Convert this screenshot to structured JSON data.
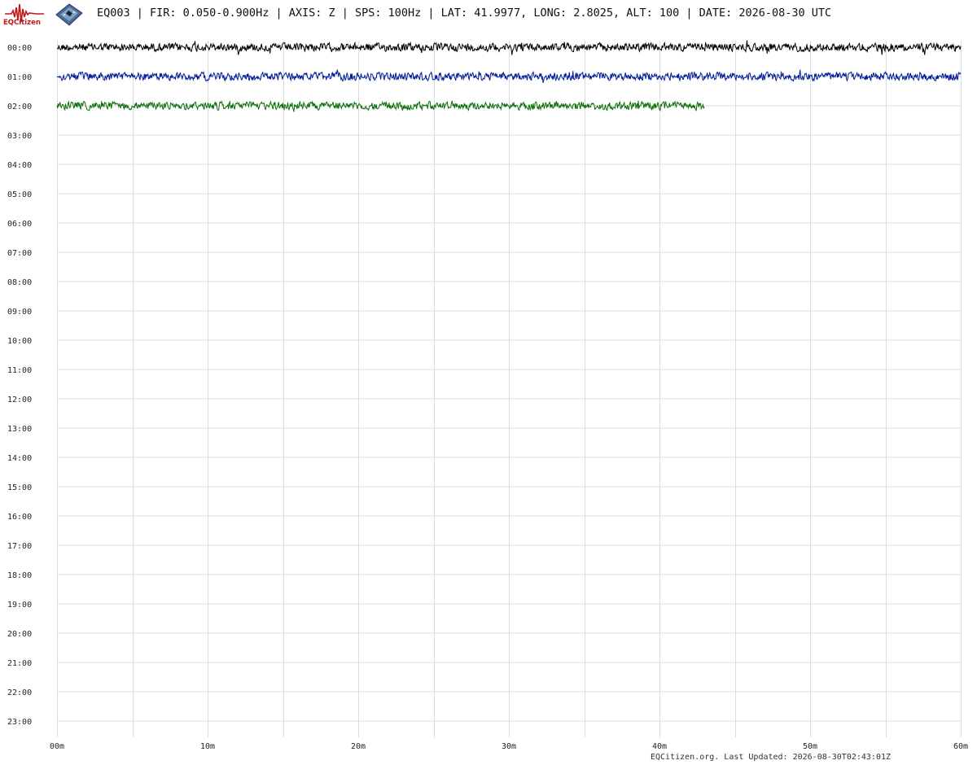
{
  "header": {
    "logo_text": "EQCitizen",
    "title": "EQ003 | FIR: 0.050-0.900Hz | AXIS: Z | SPS: 100Hz | LAT: 41.9977, LONG: 2.8025, ALT: 100 | DATE: 2026-08-30 UTC"
  },
  "footer": {
    "text": "EQCitizen.org. Last Updated: 2026-08-30T02:43:01Z"
  },
  "colors": {
    "grid": "#dcdcdc",
    "trace_colors": [
      "#000000",
      "#001a99",
      "#0a6e0a"
    ],
    "logo": "#c01818"
  },
  "icons": [
    "eqcitizen-logo-icon",
    "sensor-board-icon"
  ],
  "chart_data": {
    "type": "line",
    "title": "EQ003 | FIR: 0.050-0.900Hz | AXIS: Z | SPS: 100Hz | LAT: 41.9977, LONG: 2.8025, ALT: 100 | DATE: 2026-08-30 UTC",
    "xlabel": "",
    "ylabel": "",
    "x_ticks": [
      "00m",
      "10m",
      "20m",
      "30m",
      "40m",
      "50m",
      "60m"
    ],
    "x_range_minutes": [
      0,
      60
    ],
    "x_minor_grid_minutes": 5,
    "y_labels": [
      "00:00",
      "01:00",
      "02:00",
      "03:00",
      "04:00",
      "05:00",
      "06:00",
      "07:00",
      "08:00",
      "09:00",
      "10:00",
      "11:00",
      "12:00",
      "13:00",
      "14:00",
      "15:00",
      "16:00",
      "17:00",
      "18:00",
      "19:00",
      "20:00",
      "21:00",
      "22:00",
      "23:00"
    ],
    "grid": true,
    "series": [
      {
        "hour": "00:00",
        "end_minute": 60,
        "color": "#000000",
        "amplitude_class": "low-noise"
      },
      {
        "hour": "01:00",
        "end_minute": 60,
        "color": "#001a99",
        "amplitude_class": "low-noise"
      },
      {
        "hour": "02:00",
        "end_minute": 43,
        "color": "#0a6e0a",
        "amplitude_class": "low-noise"
      }
    ]
  }
}
